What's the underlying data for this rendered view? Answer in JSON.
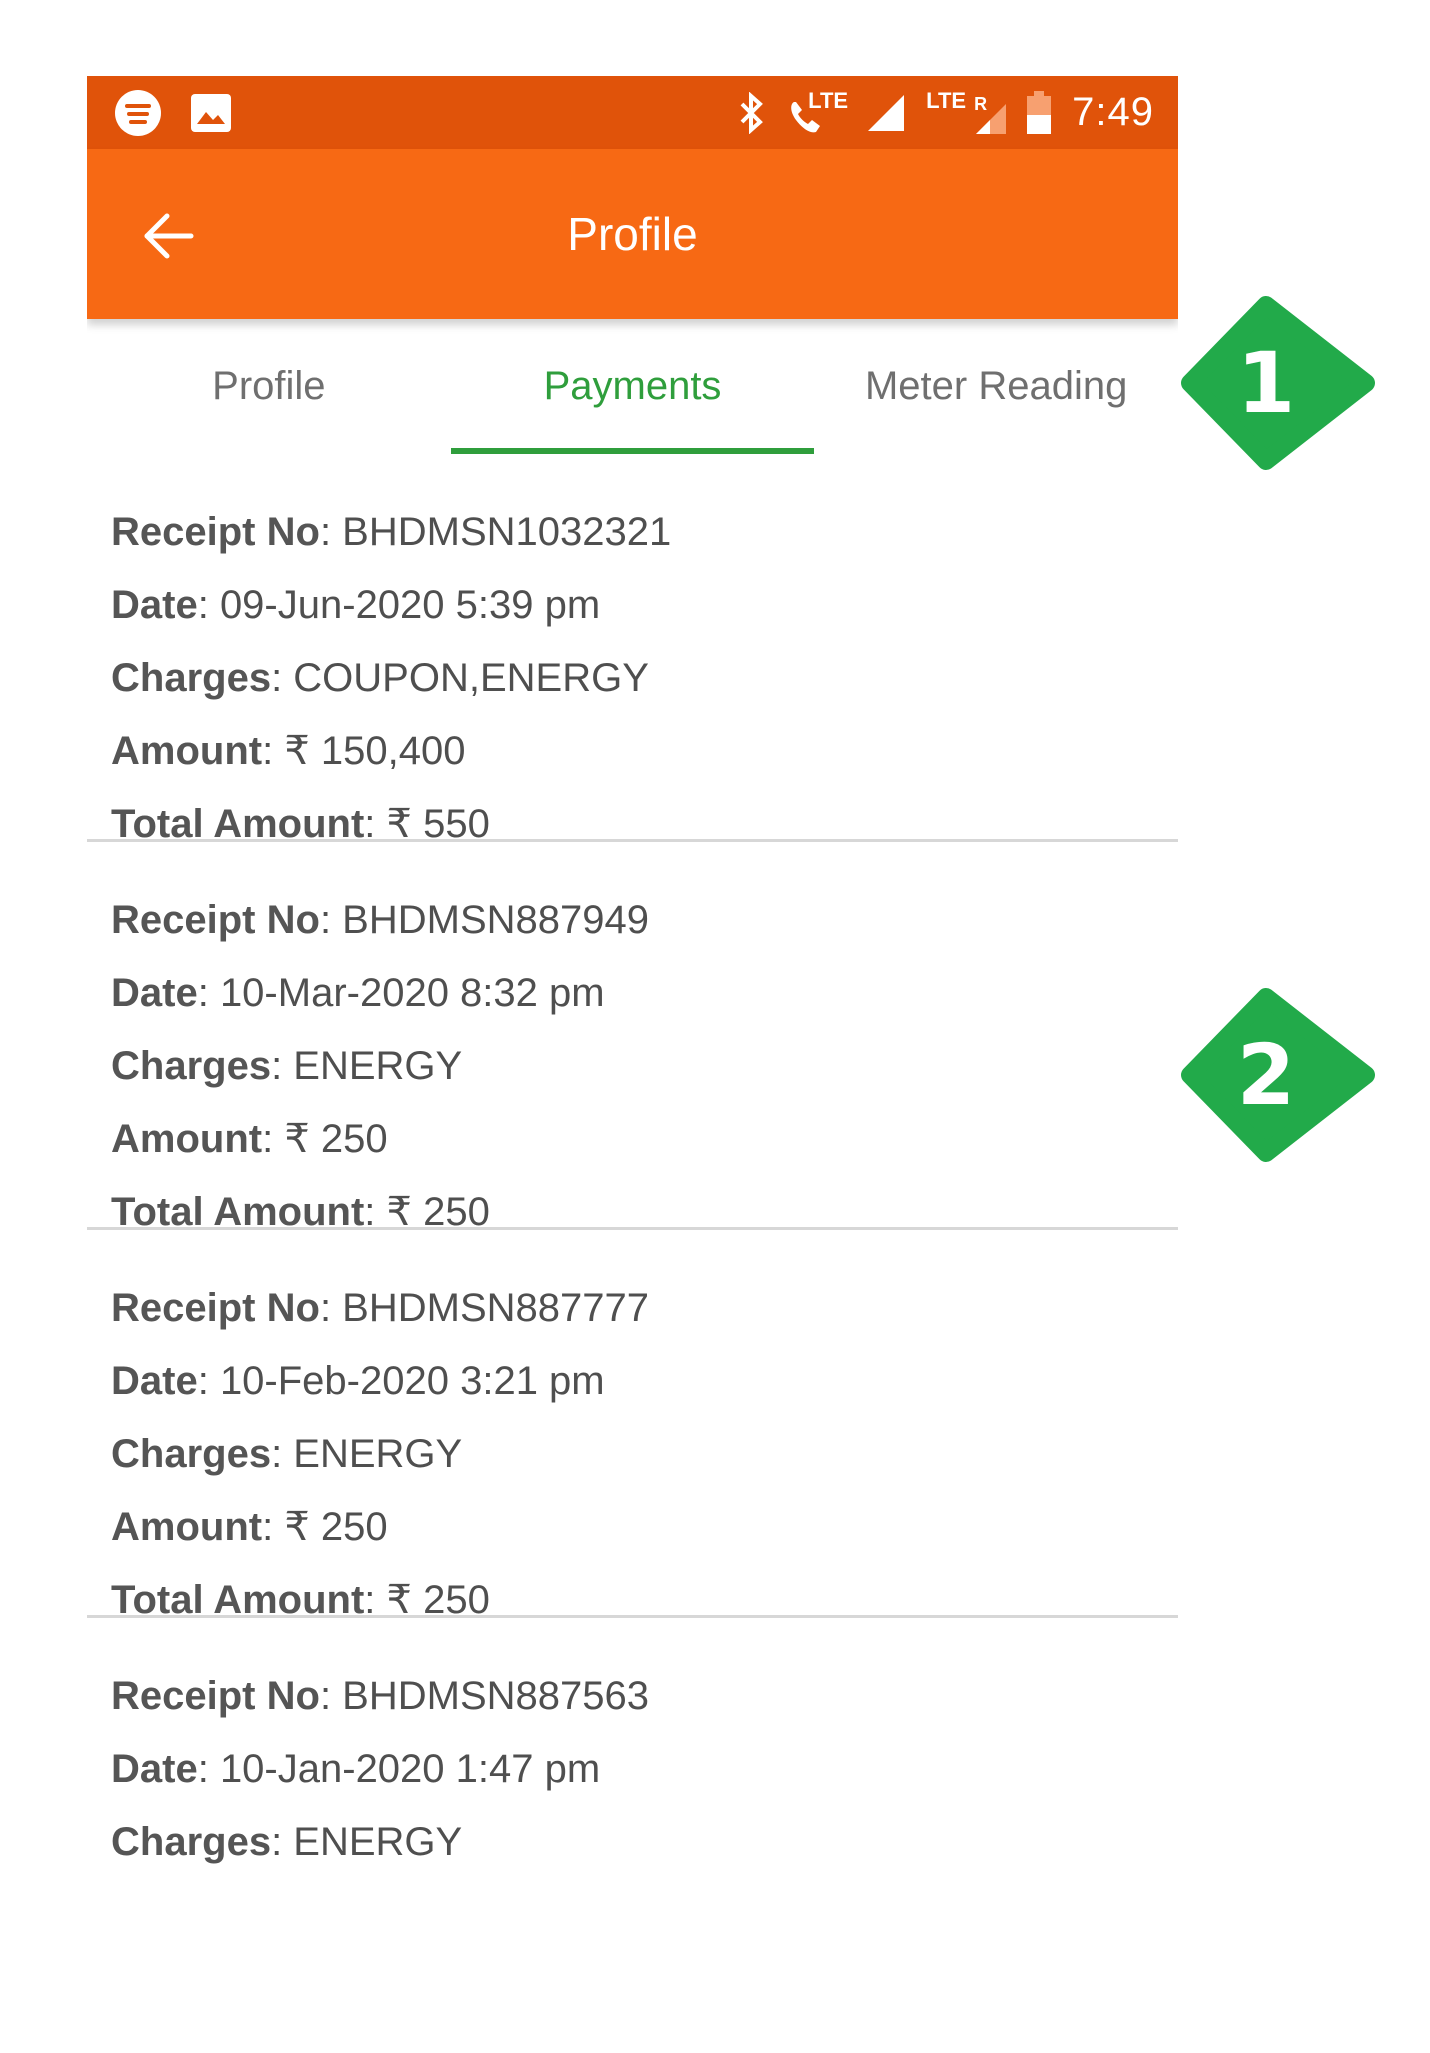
{
  "status_bar": {
    "time": "7:49",
    "lte_label_1": "LTE",
    "lte_label_2": "LTE",
    "roaming_label": "R",
    "icons": [
      "spotify-icon",
      "image-icon",
      "bluetooth-icon",
      "volte-call-icon",
      "signal-icon",
      "battery-icon"
    ],
    "background_color": "#e0530a"
  },
  "toolbar": {
    "title": "Profile",
    "back_icon": "arrow-left-icon",
    "background_color": "#f76914"
  },
  "tabs": [
    {
      "label": "Profile",
      "active": false
    },
    {
      "label": "Payments",
      "active": true
    },
    {
      "label": "Meter Reading",
      "active": false
    }
  ],
  "accent_color": "#2f9e3c",
  "receipt_labels": {
    "receipt_no": "Receipt No",
    "date": "Date",
    "charges": "Charges",
    "amount": "Amount",
    "total_amount": "Total Amount",
    "currency": "₹"
  },
  "receipts": [
    {
      "receipt_no": "BHDMSN1032321",
      "date": "09-Jun-2020 5:39 pm",
      "charges": "COUPON,ENERGY",
      "amount": "150,400",
      "total_amount": "550"
    },
    {
      "receipt_no": "BHDMSN887949",
      "date": "10-Mar-2020 8:32 pm",
      "charges": "ENERGY",
      "amount": "250",
      "total_amount": "250"
    },
    {
      "receipt_no": "BHDMSN887777",
      "date": "10-Feb-2020 3:21 pm",
      "charges": "ENERGY",
      "amount": "250",
      "total_amount": "250"
    },
    {
      "receipt_no": "BHDMSN887563",
      "date": "10-Jan-2020 1:47 pm",
      "charges": "ENERGY"
    }
  ],
  "markers": [
    {
      "number": "1"
    },
    {
      "number": "2"
    }
  ],
  "marker_color": "#22aa4a"
}
